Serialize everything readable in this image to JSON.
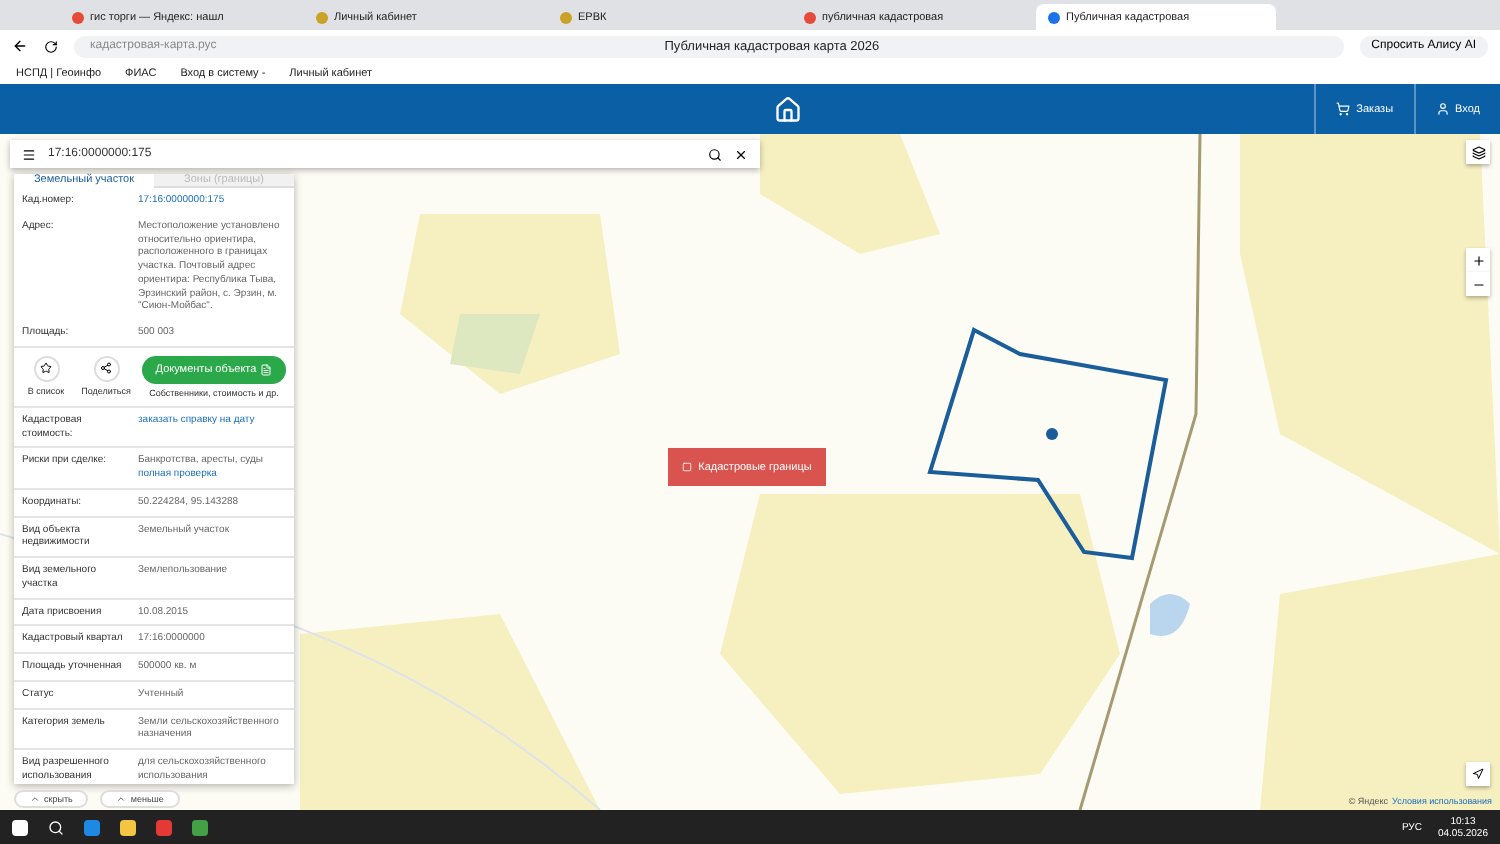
{
  "browser": {
    "tabs": [
      {
        "label": "гис торги — Яндекс: нашл",
        "selected": false
      },
      {
        "label": "Личный кабинет",
        "selected": false
      },
      {
        "label": "ЕРВК",
        "selected": false
      },
      {
        "label": "публичная кадастровая",
        "selected": false
      },
      {
        "label": "Публичная кадастровая",
        "selected": true
      }
    ],
    "address": "кадастровая-карта.рус",
    "page_title": "Публичная кадастровая карта 2026",
    "alice": "Спросить Алису AI",
    "bookmarks": [
      "НСПД | Геоинфо",
      "ФИАС",
      "Вход в систему -",
      "Личный кабинет"
    ]
  },
  "header": {
    "orders": "Заказы",
    "login": "Вход"
  },
  "search": {
    "value": "17:16:0000000:175"
  },
  "panel": {
    "tabs": [
      {
        "label": "Земельный участок",
        "selected": true
      },
      {
        "label": "Зоны (границы)",
        "selected": false
      }
    ],
    "top_rows": [
      {
        "label": "Кад.номер:",
        "value": "17:16:0000000:175",
        "link": true
      },
      {
        "label": "Адрес:",
        "value": "Местоположение установлено относительно ориентира, расположенного в границах участка. Почтовый адрес ориентира: Республика Тыва, Эрзинский район, с. Эрзин, м. \"Сиюн-Мойбас\".",
        "link": false
      },
      {
        "label": "Площадь:",
        "value": "500 003",
        "link": false
      }
    ],
    "actions": [
      {
        "label": "В список"
      },
      {
        "label": "Поделиться"
      }
    ],
    "docs_button": "Документы объекта",
    "docs_note": "Собственники, стоимость и др.",
    "rows": [
      {
        "label": "Кадастровая стоимость:",
        "value": "заказать справку на дату",
        "link": true
      },
      {
        "label": "Риски при сделке:",
        "value": "Банкротства, аресты, суды",
        "extra": "полная проверка",
        "link": false
      },
      {
        "label": "Координаты:",
        "value": "50.224284, 95.143288",
        "link": false
      },
      {
        "label": "Вид объекта недвижимости",
        "value": "Земельный участок",
        "link": false
      },
      {
        "label": "Вид земельного участка",
        "value": "Землепользование",
        "link": false
      },
      {
        "label": "Дата присвоения",
        "value": "10.08.2015",
        "link": false
      },
      {
        "label": "Кадастровый квартал",
        "value": "17:16:0000000",
        "link": false
      },
      {
        "label": "Площадь уточненная",
        "value": "500000 кв. м",
        "link": false
      },
      {
        "label": "Статус",
        "value": "Учтенный",
        "link": false
      },
      {
        "label": "Категория земель",
        "value": "Земли сельскохозяйственного назначения",
        "link": false
      },
      {
        "label": "Вид разрешенного использования",
        "value": "для сельскохозяйственного использования",
        "link": false
      }
    ]
  },
  "bottom_buttons": [
    "скрыть",
    "меньше"
  ],
  "map": {
    "boundary_button": "Кадастровые границы",
    "attribution": "© Яндекс",
    "terms": "Условия использования"
  },
  "taskbar": {
    "lang": "РУС",
    "time": "10:13",
    "date": "04.05.2026"
  }
}
